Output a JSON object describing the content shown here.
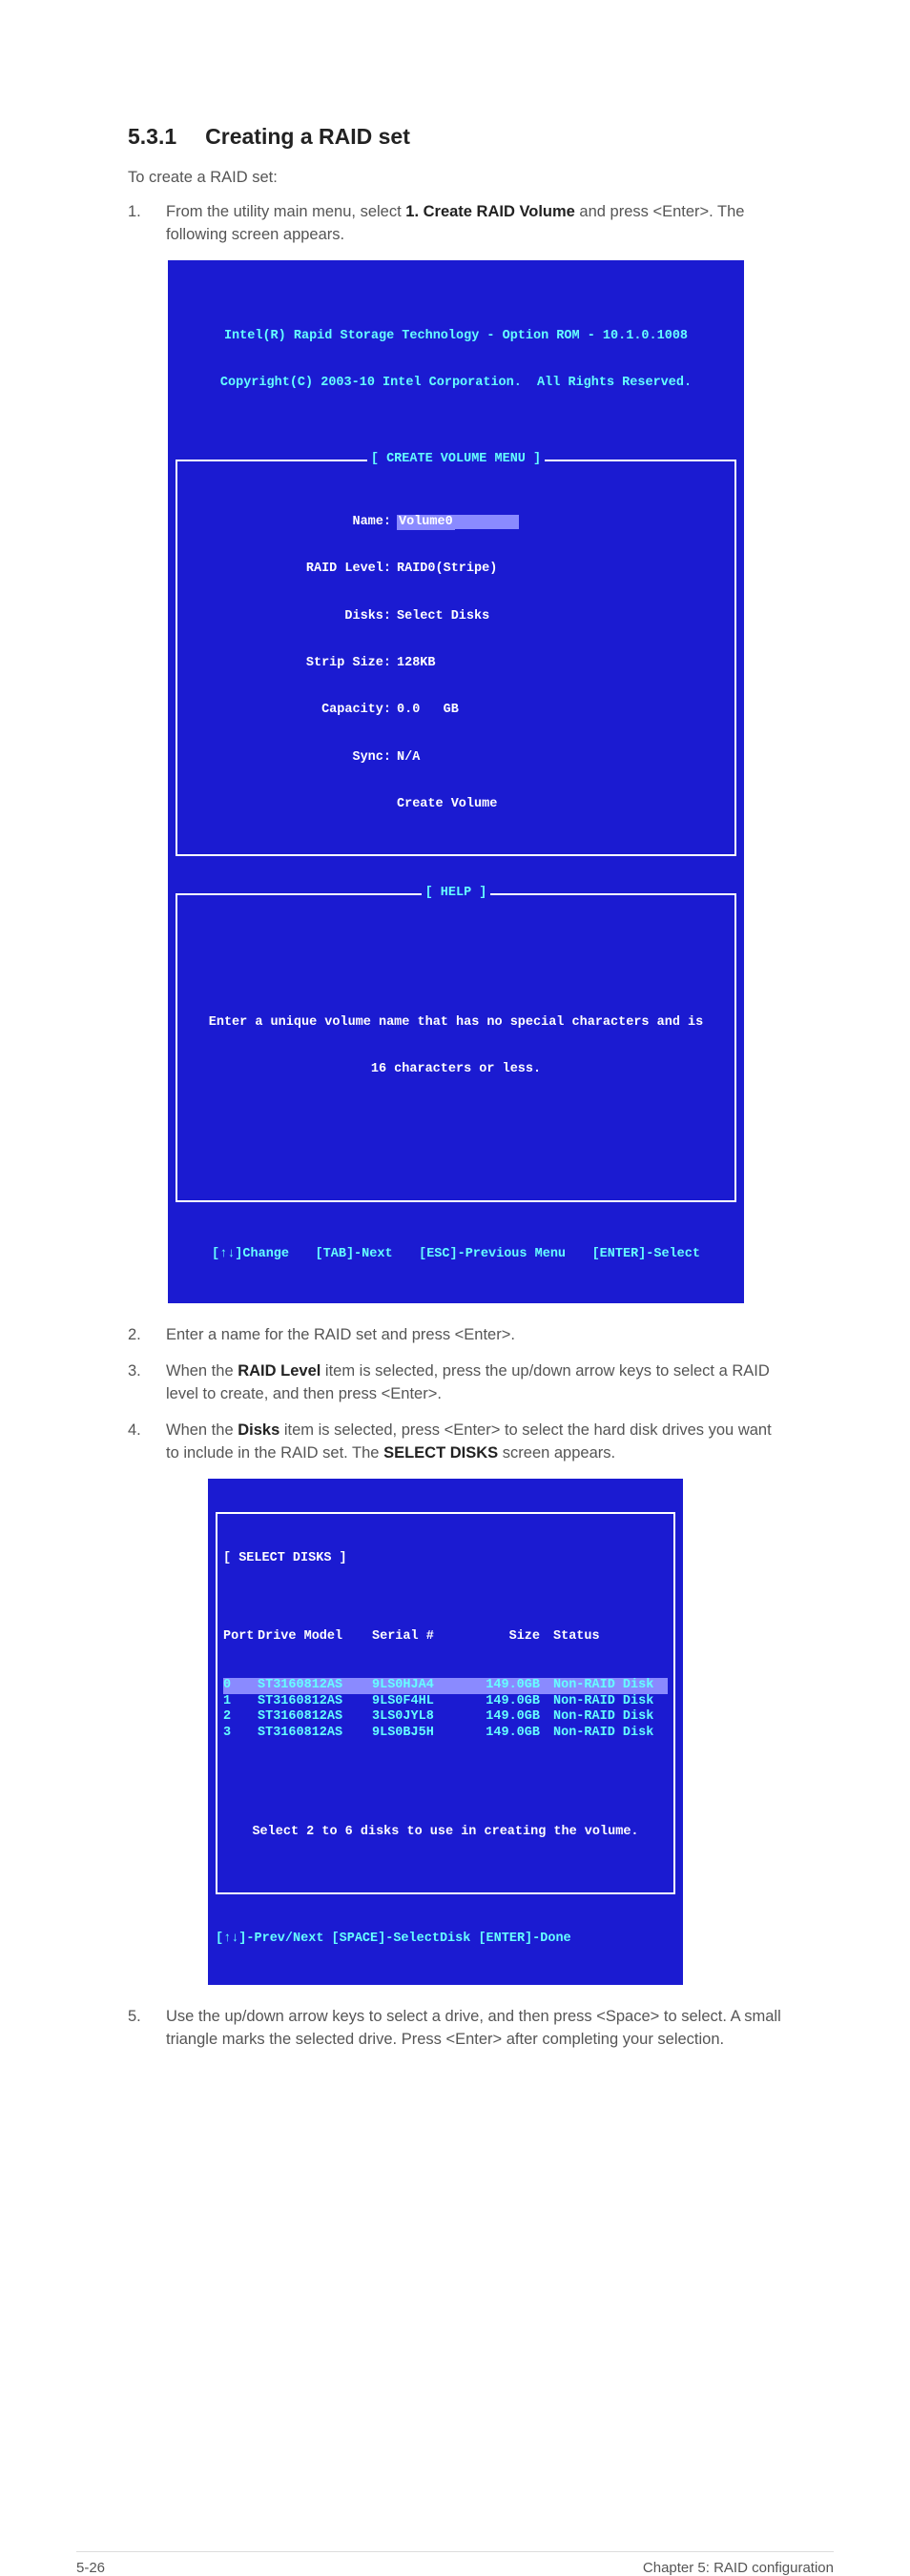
{
  "heading": {
    "number": "5.3.1",
    "title": "Creating a RAID set"
  },
  "intro": "To create a RAID set:",
  "steps": {
    "s1": {
      "num": "1.",
      "pre": "From the utility main menu, select ",
      "bold": "1. Create RAID Volume",
      "post": " and press <Enter>. The following screen appears."
    },
    "s2": {
      "num": "2.",
      "text": "Enter a name for the RAID set and press <Enter>."
    },
    "s3": {
      "num": "3.",
      "pre": "When the ",
      "bold": "RAID Level",
      "post": " item is selected, press the up/down arrow keys to select a RAID level to create, and then press <Enter>."
    },
    "s4": {
      "num": "4.",
      "pre": "When the ",
      "bold1": "Disks",
      "mid": " item is selected, press <Enter> to select the hard disk drives you want to include in the RAID set. The ",
      "bold2": "SELECT DISKS",
      "post": " screen appears."
    },
    "s5": {
      "num": "5.",
      "text": "Use the up/down arrow keys to select a drive, and then press <Space> to select. A small triangle marks the selected drive. Press <Enter> after completing your selection."
    }
  },
  "bios": {
    "hdr1": "Intel(R) Rapid Storage Technology - Option ROM - 10.1.0.1008",
    "hdr2": "Copyright(C) 2003-10 Intel Corporation.  All Rights Reserved.",
    "menutitle": "[ CREATE VOLUME MENU ]",
    "fields": {
      "name_lbl": "Name:",
      "name_val": "Volume0",
      "raid_lbl": "RAID Level:",
      "raid_val": "RAID0(Stripe)",
      "disks_lbl": "Disks:",
      "disks_val": "Select Disks",
      "strip_lbl": "Strip Size:",
      "strip_val": "128KB",
      "cap_lbl": "Capacity:",
      "cap_val": "0.0   GB",
      "sync_lbl": "Sync:",
      "sync_val": "N/A",
      "create": "Create Volume"
    },
    "helptitle": "[ HELP ]",
    "help1": "Enter a unique volume name that has no special characters and is",
    "help2": "16 characters or less.",
    "foot": {
      "a": "[↑↓]Change",
      "b": "[TAB]-Next",
      "c": "[ESC]-Previous Menu",
      "d": "[ENTER]-Select"
    }
  },
  "selectdisks": {
    "title": "[ SELECT DISKS ]",
    "headers": {
      "port": "Port",
      "model": "Drive Model",
      "serial": "Serial #",
      "size": "Size",
      "status": "Status"
    },
    "rows": [
      {
        "port": "0",
        "model": "ST3160812AS",
        "serial": "9LS0HJA4",
        "size": "149.0GB",
        "status": "Non-RAID Disk"
      },
      {
        "port": "1",
        "model": "ST3160812AS",
        "serial": "9LS0F4HL",
        "size": "149.0GB",
        "status": "Non-RAID Disk"
      },
      {
        "port": "2",
        "model": "ST3160812AS",
        "serial": "3LS0JYL8",
        "size": "149.0GB",
        "status": "Non-RAID Disk"
      },
      {
        "port": "3",
        "model": "ST3160812AS",
        "serial": "9LS0BJ5H",
        "size": "149.0GB",
        "status": "Non-RAID Disk"
      }
    ],
    "note": "Select 2 to 6 disks to use in creating the volume.",
    "footer": "[↑↓]-Prev/Next [SPACE]-SelectDisk [ENTER]-Done"
  },
  "footer": {
    "left": "5-26",
    "right": "Chapter 5: RAID configuration"
  }
}
